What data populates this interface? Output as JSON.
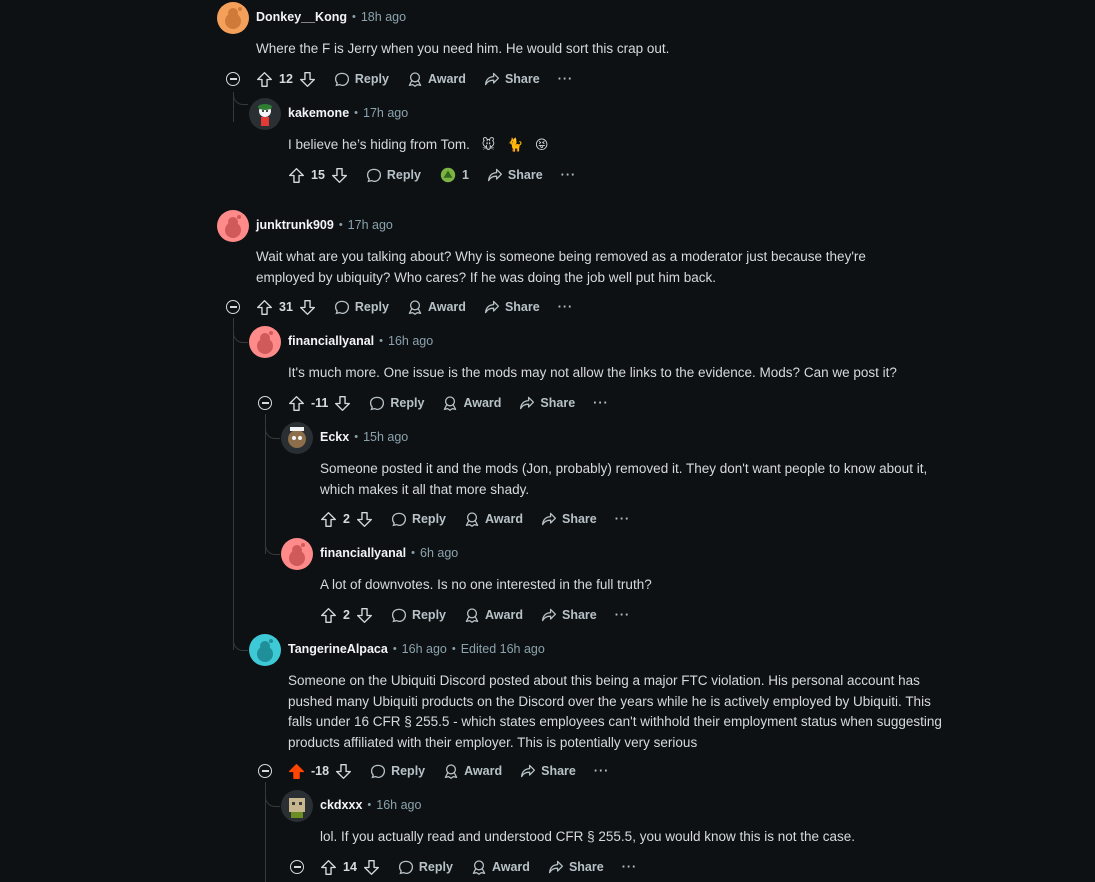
{
  "labels": {
    "reply": "Reply",
    "award": "Award",
    "share": "Share",
    "more": "···",
    "dot": "•"
  },
  "colors": {
    "background": "#0e1113",
    "upvoted": "#ff4500"
  },
  "comments": [
    {
      "user": "Donkey__Kong",
      "time": "18h ago",
      "body": "Where the F is Jerry when you need him. He would sort this crap out.",
      "votes": "12",
      "avatar_color": "#f5a05a"
    },
    {
      "user": "kakemone",
      "time": "17h ago",
      "body": "I believe he’s hiding from Tom.",
      "emojis": [
        "🐭",
        "🐈",
        "😝"
      ],
      "votes": "15",
      "award_count": "1"
    },
    {
      "user": "junktrunk909",
      "time": "17h ago",
      "body": "Wait what are you talking about? Why is someone being removed as a moderator just because they're employed by ubiquity? Who cares? If he was doing the job well put him back.",
      "votes": "31",
      "avatar_color": "#ff8a8a"
    },
    {
      "user": "financiallyanal",
      "time": "16h ago",
      "body": "It's much more. One issue is the mods may not allow the links to the evidence. Mods? Can we post it?",
      "votes": "-11",
      "avatar_color": "#ff8a8a"
    },
    {
      "user": "Eckx",
      "time": "15h ago",
      "body": "Someone posted it and the mods (Jon, probably) removed it. They don't want people to know about it, which makes it all that more shady.",
      "votes": "2"
    },
    {
      "user": "financiallyanal",
      "time": "6h ago",
      "body": "A lot of downvotes. Is no one interested in the full truth?",
      "votes": "2",
      "avatar_color": "#ff8a8a"
    },
    {
      "user": "TangerineAlpaca",
      "time": "16h ago",
      "edited": "Edited 16h ago",
      "body": "Someone on the Ubiquiti Discord posted about this being a major FTC violation. His personal account has pushed many Ubiquiti products on the Discord over the years while he is actively employed by Ubiquiti. This falls under 16 CFR § 255.5 - which states employees can't withhold their employment status when suggesting products affiliated with their employer. This is potentially very serious",
      "votes": "-18",
      "upvoted": true,
      "avatar_color": "#3ec9d6"
    },
    {
      "user": "ckdxxx",
      "time": "16h ago",
      "body": "lol. If you actually read and understood CFR § 255.5, you would know this is not the case.",
      "votes": "14"
    }
  ]
}
